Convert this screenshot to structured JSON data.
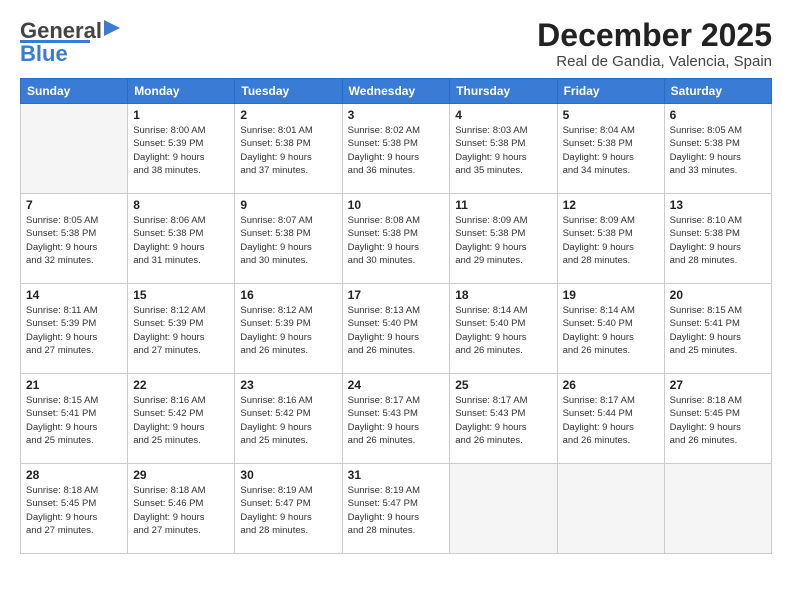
{
  "header": {
    "logo_general": "General",
    "logo_blue": "Blue",
    "title": "December 2025",
    "subtitle": "Real de Gandia, Valencia, Spain"
  },
  "weekdays": [
    "Sunday",
    "Monday",
    "Tuesday",
    "Wednesday",
    "Thursday",
    "Friday",
    "Saturday"
  ],
  "weeks": [
    [
      {
        "day": "",
        "info": ""
      },
      {
        "day": "1",
        "info": "Sunrise: 8:00 AM\nSunset: 5:39 PM\nDaylight: 9 hours\nand 38 minutes."
      },
      {
        "day": "2",
        "info": "Sunrise: 8:01 AM\nSunset: 5:38 PM\nDaylight: 9 hours\nand 37 minutes."
      },
      {
        "day": "3",
        "info": "Sunrise: 8:02 AM\nSunset: 5:38 PM\nDaylight: 9 hours\nand 36 minutes."
      },
      {
        "day": "4",
        "info": "Sunrise: 8:03 AM\nSunset: 5:38 PM\nDaylight: 9 hours\nand 35 minutes."
      },
      {
        "day": "5",
        "info": "Sunrise: 8:04 AM\nSunset: 5:38 PM\nDaylight: 9 hours\nand 34 minutes."
      },
      {
        "day": "6",
        "info": "Sunrise: 8:05 AM\nSunset: 5:38 PM\nDaylight: 9 hours\nand 33 minutes."
      }
    ],
    [
      {
        "day": "7",
        "info": "Sunrise: 8:05 AM\nSunset: 5:38 PM\nDaylight: 9 hours\nand 32 minutes."
      },
      {
        "day": "8",
        "info": "Sunrise: 8:06 AM\nSunset: 5:38 PM\nDaylight: 9 hours\nand 31 minutes."
      },
      {
        "day": "9",
        "info": "Sunrise: 8:07 AM\nSunset: 5:38 PM\nDaylight: 9 hours\nand 30 minutes."
      },
      {
        "day": "10",
        "info": "Sunrise: 8:08 AM\nSunset: 5:38 PM\nDaylight: 9 hours\nand 30 minutes."
      },
      {
        "day": "11",
        "info": "Sunrise: 8:09 AM\nSunset: 5:38 PM\nDaylight: 9 hours\nand 29 minutes."
      },
      {
        "day": "12",
        "info": "Sunrise: 8:09 AM\nSunset: 5:38 PM\nDaylight: 9 hours\nand 28 minutes."
      },
      {
        "day": "13",
        "info": "Sunrise: 8:10 AM\nSunset: 5:38 PM\nDaylight: 9 hours\nand 28 minutes."
      }
    ],
    [
      {
        "day": "14",
        "info": "Sunrise: 8:11 AM\nSunset: 5:39 PM\nDaylight: 9 hours\nand 27 minutes."
      },
      {
        "day": "15",
        "info": "Sunrise: 8:12 AM\nSunset: 5:39 PM\nDaylight: 9 hours\nand 27 minutes."
      },
      {
        "day": "16",
        "info": "Sunrise: 8:12 AM\nSunset: 5:39 PM\nDaylight: 9 hours\nand 26 minutes."
      },
      {
        "day": "17",
        "info": "Sunrise: 8:13 AM\nSunset: 5:40 PM\nDaylight: 9 hours\nand 26 minutes."
      },
      {
        "day": "18",
        "info": "Sunrise: 8:14 AM\nSunset: 5:40 PM\nDaylight: 9 hours\nand 26 minutes."
      },
      {
        "day": "19",
        "info": "Sunrise: 8:14 AM\nSunset: 5:40 PM\nDaylight: 9 hours\nand 26 minutes."
      },
      {
        "day": "20",
        "info": "Sunrise: 8:15 AM\nSunset: 5:41 PM\nDaylight: 9 hours\nand 25 minutes."
      }
    ],
    [
      {
        "day": "21",
        "info": "Sunrise: 8:15 AM\nSunset: 5:41 PM\nDaylight: 9 hours\nand 25 minutes."
      },
      {
        "day": "22",
        "info": "Sunrise: 8:16 AM\nSunset: 5:42 PM\nDaylight: 9 hours\nand 25 minutes."
      },
      {
        "day": "23",
        "info": "Sunrise: 8:16 AM\nSunset: 5:42 PM\nDaylight: 9 hours\nand 25 minutes."
      },
      {
        "day": "24",
        "info": "Sunrise: 8:17 AM\nSunset: 5:43 PM\nDaylight: 9 hours\nand 26 minutes."
      },
      {
        "day": "25",
        "info": "Sunrise: 8:17 AM\nSunset: 5:43 PM\nDaylight: 9 hours\nand 26 minutes."
      },
      {
        "day": "26",
        "info": "Sunrise: 8:17 AM\nSunset: 5:44 PM\nDaylight: 9 hours\nand 26 minutes."
      },
      {
        "day": "27",
        "info": "Sunrise: 8:18 AM\nSunset: 5:45 PM\nDaylight: 9 hours\nand 26 minutes."
      }
    ],
    [
      {
        "day": "28",
        "info": "Sunrise: 8:18 AM\nSunset: 5:45 PM\nDaylight: 9 hours\nand 27 minutes."
      },
      {
        "day": "29",
        "info": "Sunrise: 8:18 AM\nSunset: 5:46 PM\nDaylight: 9 hours\nand 27 minutes."
      },
      {
        "day": "30",
        "info": "Sunrise: 8:19 AM\nSunset: 5:47 PM\nDaylight: 9 hours\nand 28 minutes."
      },
      {
        "day": "31",
        "info": "Sunrise: 8:19 AM\nSunset: 5:47 PM\nDaylight: 9 hours\nand 28 minutes."
      },
      {
        "day": "",
        "info": ""
      },
      {
        "day": "",
        "info": ""
      },
      {
        "day": "",
        "info": ""
      }
    ]
  ]
}
